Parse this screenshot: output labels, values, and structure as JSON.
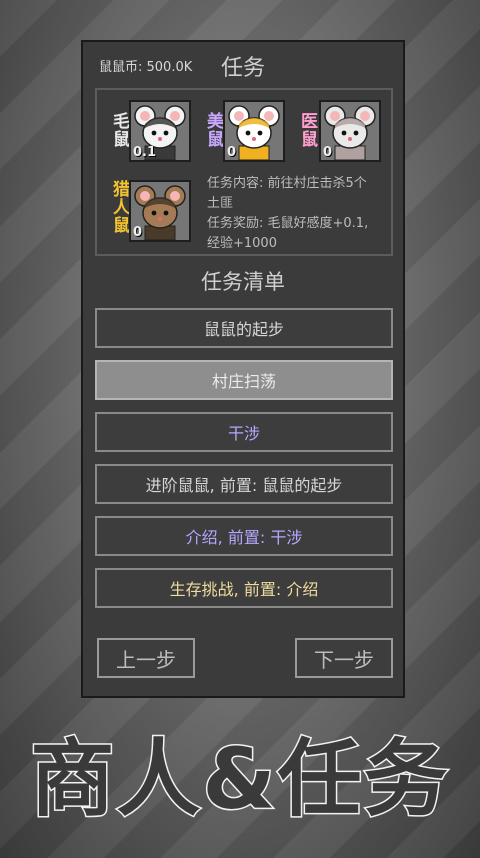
{
  "header": {
    "currency": "鼠鼠币: 500.0K",
    "title": "任务"
  },
  "party": [
    {
      "name": "毛鼠",
      "level": "0.1",
      "name_color": "#e8e8e8",
      "fur": "#f3f3f3",
      "accent": "#3a3a3a"
    },
    {
      "name": "美鼠",
      "level": "0",
      "name_color": "#c9a8ff",
      "fur": "#ffffff",
      "accent": "#f0b020"
    },
    {
      "name": "医鼠",
      "level": "0",
      "name_color": "#ff9fd0",
      "fur": "#e9e9e9",
      "accent": "#b0a0a0"
    },
    {
      "name": "猎人鼠",
      "level": "0",
      "name_color": "#f4c430",
      "fur": "#a57b55",
      "accent": "#4a3a2a"
    }
  ],
  "task_info": {
    "content": "任务内容: 前往村庄击杀5个土匪",
    "reward": "任务奖励: 毛鼠好感度+0.1, 经验+1000"
  },
  "list_title": "任务清单",
  "tasks": [
    {
      "label": "鼠鼠的起步",
      "color": "#d6d6d6",
      "selected": false
    },
    {
      "label": "村庄扫荡",
      "color": "#ececec",
      "selected": true
    },
    {
      "label": "干涉",
      "color": "#b7a6ff",
      "selected": false
    },
    {
      "label": "进阶鼠鼠, 前置: 鼠鼠的起步",
      "color": "#d6d6d6",
      "selected": false
    },
    {
      "label": "介绍, 前置: 干涉",
      "color": "#b7a6ff",
      "selected": false
    },
    {
      "label": "生存挑战, 前置: 介绍",
      "color": "#f0dca0",
      "selected": false
    }
  ],
  "nav": {
    "prev": "上一步",
    "next": "下一步"
  },
  "banner": "商人&任务",
  "colors": {
    "panel": "#3b3b3b",
    "selected": "#8e8e8e"
  }
}
